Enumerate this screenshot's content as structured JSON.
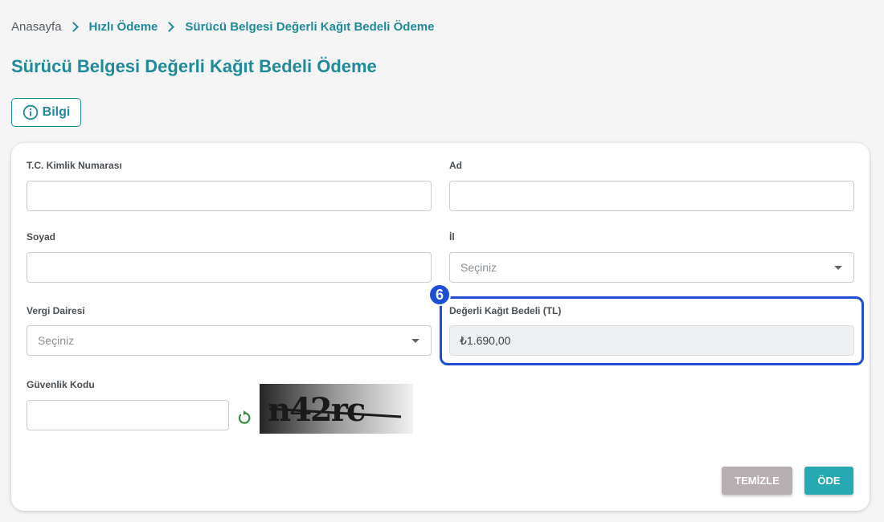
{
  "breadcrumb": {
    "items": [
      "Anasayfa",
      "Hızlı Ödeme",
      "Sürücü Belgesi Değerli Kağıt Bedeli Ödeme"
    ]
  },
  "page": {
    "title": "Sürücü Belgesi Değerli Kağıt Bedeli Ödeme"
  },
  "info_button": {
    "label": "Bilgi",
    "icon": "info-circle-icon"
  },
  "form": {
    "tc_kimlik": {
      "label": "T.C. Kimlik Numarası",
      "value": ""
    },
    "ad": {
      "label": "Ad",
      "value": ""
    },
    "soyad": {
      "label": "Soyad",
      "value": ""
    },
    "il": {
      "label": "İl",
      "selected": "Seçiniz"
    },
    "vergi_dairesi": {
      "label": "Vergi Dairesi",
      "selected": "Seçiniz"
    },
    "degerli_kagit_bedeli": {
      "label": "Değerli Kağıt Bedeli (TL)",
      "value": "₺1.690,00"
    },
    "guvenlik_kodu": {
      "label": "Güvenlik Kodu",
      "value": "",
      "captcha_text": "n42rc",
      "refresh_icon": "refresh-icon"
    }
  },
  "annotation": {
    "step_number": "6",
    "color": "#1d4fd6"
  },
  "buttons": {
    "clear": "TEMİZLE",
    "pay": "ÖDE"
  },
  "colors": {
    "accent": "#1f8a9a",
    "pay_button": "#26a9b3",
    "clear_button": "#b7afb2",
    "refresh_icon": "#2f8a3a"
  }
}
